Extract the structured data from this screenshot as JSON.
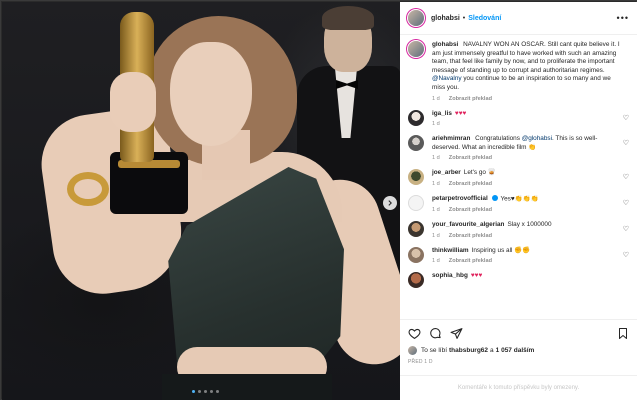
{
  "post": {
    "author": "glohabsi",
    "follow_label": "Sledování",
    "separator": "•"
  },
  "caption": {
    "user": "glohabsi",
    "text_before": "NAVALNY WON AN OSCAR. Still cant quite believe it. I am just immensely greatful to have worked with such an amazing team, that feel like family by now, and to proliferate the important message of standing up to corrupt and authoritarian regimes.",
    "mention": "@Navalny",
    "text_after": "you continue to be an inspiration to so many and we miss you.",
    "time": "1 d",
    "translate": "Zobrazit překlad"
  },
  "comments": [
    {
      "user": "iga_lis",
      "text": "♥♥♥",
      "time": "1 d",
      "translate": ""
    },
    {
      "user": "ariehmimran",
      "text_before": "Congratulations",
      "mention": "@glohabsi",
      "text_after": ". This is so well-deserved. What an incredible film 👏",
      "time": "1 d",
      "translate": "Zobrazit překlad"
    },
    {
      "user": "joe_arber",
      "text": "Let's go 🥃",
      "time": "1 d",
      "translate": "Zobrazit překlad"
    },
    {
      "user": "petarpetrovofficial",
      "text": "Yes♥👏👏👏",
      "time": "1 d",
      "translate": "Zobrazit překlad"
    },
    {
      "user": "your_favourite_algerian",
      "text": "Slay x 1000000",
      "time": "1 d",
      "translate": "Zobrazit překlad"
    },
    {
      "user": "thinkwilliam",
      "text": "Inspiring us all ✊✊",
      "time": "1 d",
      "translate": "Zobrazit překlad"
    },
    {
      "user": "sophia_hbg",
      "text": "♥♥♥",
      "time": "",
      "translate": ""
    }
  ],
  "likes": {
    "prefix": "To se líbí",
    "user": "thabsburg62",
    "middle": "a",
    "count": "1 057 dalším"
  },
  "date": "PŘED 1 D",
  "add_comment_placeholder": "Komentáře k tomuto příspěvku byly omezeny.",
  "carousel": {
    "total": 5,
    "active": 0
  },
  "colors": {
    "accent": "#0095f6",
    "heart": "#e0245e"
  },
  "icons": [
    "more-icon",
    "heart-icon",
    "comment-icon",
    "share-icon",
    "save-icon",
    "chevron-right-icon"
  ]
}
